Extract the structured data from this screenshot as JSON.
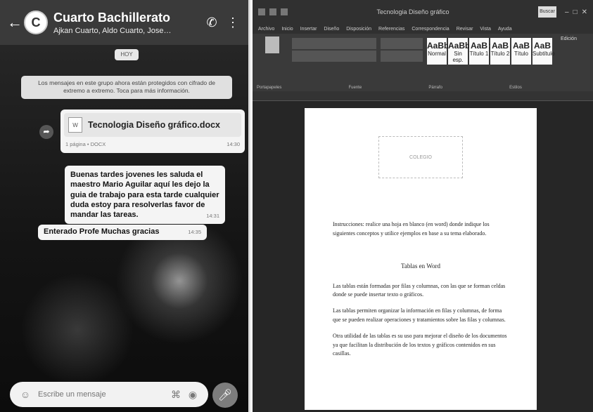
{
  "chat": {
    "title": "Cuarto Bachillerato",
    "members": "Ajkan Cuarto, Aldo Cuarto, Jose…",
    "date_chip": "HOY",
    "system_message": "Los mensajes en este grupo ahora están protegidos con cifrado de extremo a extremo. Toca para más información.",
    "document": {
      "name": "Tecnologia Diseño gráfico.docx",
      "meta": "1 página • DOCX",
      "time": "14:30"
    },
    "message": {
      "text": "Buenas tardes jovenes les saluda el maestro Mario Aguilar aquí les dejo la guia de trabajo para esta tarde cualquier duda estoy para resolverlas favor de mandar las tareas.",
      "time": "14:31"
    },
    "reply": {
      "text": "Enterado Profe Muchas gracias",
      "time": "14:35"
    },
    "input_placeholder": "Escribe un mensaje"
  },
  "word": {
    "title": "Tecnologia Diseño gráfico",
    "search_label": "Buscar",
    "tabs": [
      "Archivo",
      "Inicio",
      "Insertar",
      "Diseño",
      "Disposición",
      "Referencias",
      "Correspondencia",
      "Revisar",
      "Vista",
      "Ayuda"
    ],
    "ribbon_groups": [
      "Portapapeles",
      "Fuente",
      "Párrafo",
      "Estilos",
      "Edición"
    ],
    "styles": [
      {
        "sample": "AaBbCcDd",
        "name": "Normal"
      },
      {
        "sample": "AaBbCcDd",
        "name": "Sin esp."
      },
      {
        "sample": "AaB",
        "name": "Título 1"
      },
      {
        "sample": "AaB",
        "name": "Título 2"
      },
      {
        "sample": "AaB",
        "name": "Título"
      },
      {
        "sample": "AaB",
        "name": "Subtítulo"
      }
    ],
    "logo_text": "COLEGIO",
    "paragraph_1": "Instrucciones: realice una hoja en blanco (en word) donde indique los siguientes conceptos y utilice ejemplos en base a su tema elaborado.",
    "heading": "Tablas en Word",
    "paragraph_2": "Las tablas están formadas por filas y columnas, con las que se forman celdas donde se puede insertar texto o gráficos.",
    "paragraph_3": "Las tablas permiten organizar la información en filas y columnas, de forma que se pueden realizar operaciones y tratamientos sobre las filas y columnas.",
    "paragraph_4": "Otra utilidad de las tablas es su uso para mejorar el diseño de los documentos ya que facilitan la distribución de los textos y gráficos contenidos en sus casillas."
  }
}
